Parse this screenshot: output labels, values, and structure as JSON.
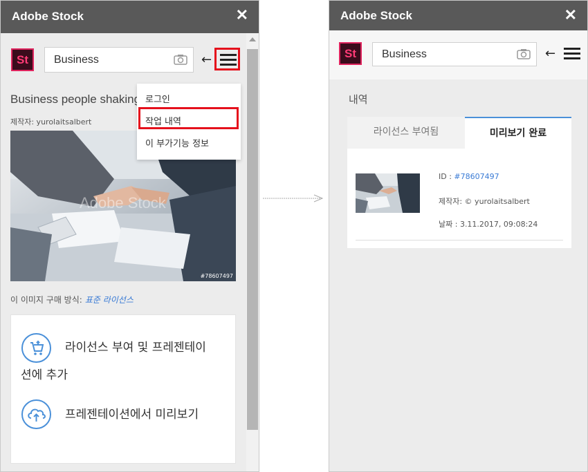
{
  "left_panel": {
    "app_title": "Adobe Stock",
    "close_glyph": "✕",
    "logo_text": "St",
    "search_value": "Business",
    "back_glyph": "←",
    "dropdown": {
      "login": "로그인",
      "history": "작업 내역",
      "about": "이 부가기능 정보"
    },
    "image_title": "Business people shaking",
    "creator_line": "제작자: yurolaitsalbert",
    "photo_id": "#78607497",
    "watermark": "Adobe Stock",
    "license_prefix": "이 이미지 구매 방식:",
    "license_link": "표준 라이선스",
    "actions": {
      "license_add_line1": "라이선스 부여 및 프레젠테이",
      "license_add_line2": "션에 추가",
      "preview": "프레젠테이션에서 미리보기"
    }
  },
  "right_panel": {
    "app_title": "Adobe Stock",
    "close_glyph": "✕",
    "logo_text": "St",
    "search_value": "Business",
    "back_glyph": "←",
    "history_label": "내역",
    "tabs": {
      "licensed": "라이선스 부여됨",
      "preview_done": "미리보기 완료"
    },
    "entry": {
      "id_prefix": "ID : ",
      "id_value": "#78607497",
      "creator": "제작자: © yurolaitsalbert",
      "date": "날짜 : 3.11.2017, 09:08:24"
    }
  },
  "colors": {
    "titlebar": "#595959",
    "accent_blue": "#4a90d9",
    "highlight_red": "#e5101c",
    "logo_pink": "#ff3b76"
  },
  "icons": [
    "close-icon",
    "camera-icon",
    "back-arrow-icon",
    "hamburger-menu-icon",
    "cart-add-icon",
    "cloud-upload-icon",
    "right-arrow-icon"
  ]
}
